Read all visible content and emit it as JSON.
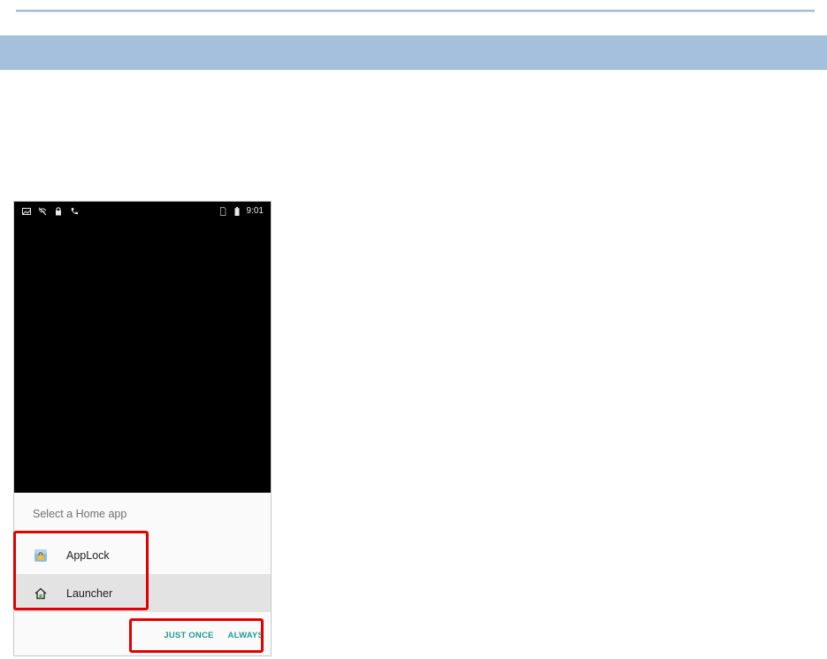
{
  "document": {
    "section_heading": ""
  },
  "phone": {
    "status_bar": {
      "left_icons": [
        "image-icon",
        "wifi-off-icon",
        "lock-icon",
        "phone-icon"
      ],
      "right_icons": [
        "sim-icon",
        "battery-icon"
      ],
      "time": "9:01"
    },
    "dialog": {
      "title": "Select a Home app",
      "options": [
        {
          "label": "AppLock",
          "icon": "applock-app-icon",
          "selected": false
        },
        {
          "label": "Launcher",
          "icon": "home-icon",
          "selected": true
        }
      ],
      "buttons": {
        "just_once": "JUST ONCE",
        "always": "ALWAYS"
      }
    }
  },
  "colors": {
    "section_band": "#a4c0dc",
    "accent_button": "#1e9b95",
    "highlight": "#e00000"
  }
}
